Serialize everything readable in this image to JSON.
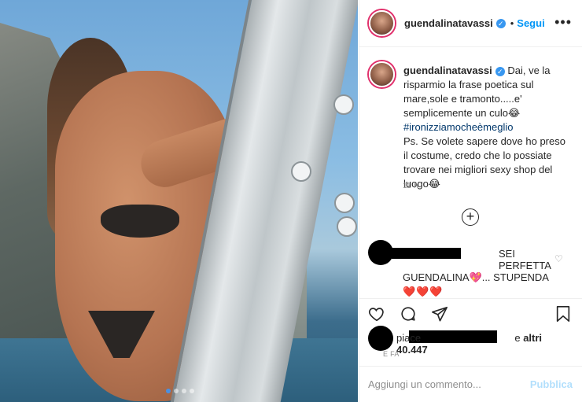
{
  "post": {
    "username": "guendalinatavassi",
    "follow_label": "Segui",
    "more_label": "•••",
    "separator": "•",
    "caption": {
      "line1": "Dai, ve la risparmio la frase poetica sul mare,sole e tramonto.....e' semplicemente un culo😂",
      "hashtag": "#ironizziamocheèmeglio",
      "line2": "Ps. Se volete sapere dove ho preso il costume, credo che lo possiate trovare nei migliori sexy shop del luogo😂"
    },
    "time": "11 h",
    "load_more_symbol": "+",
    "comment": {
      "text_first": "SEI PERFETTA",
      "text_second": "GUENDALINA💖... STUPENDA",
      "hearts": "❤️❤️❤️"
    },
    "likes": {
      "prefix": "piace",
      "suffix": "e",
      "others": "altri 40.447"
    },
    "ago": "E FA",
    "composer": {
      "placeholder": "Aggiungi un commento...",
      "submit_label": "Pubblica"
    },
    "carousel": {
      "total": 4,
      "active": 1
    }
  },
  "colors": {
    "accent": "#0095f6",
    "verified": "#3897f0",
    "hashtag": "#00376b",
    "muted": "#8e8e8e",
    "post_disabled": "#b2dffc"
  },
  "icons": [
    "verified-badge-icon",
    "more-options-icon",
    "add-circle-icon",
    "heart-icon",
    "comment-icon",
    "share-icon",
    "bookmark-icon",
    "small-heart-icon"
  ]
}
